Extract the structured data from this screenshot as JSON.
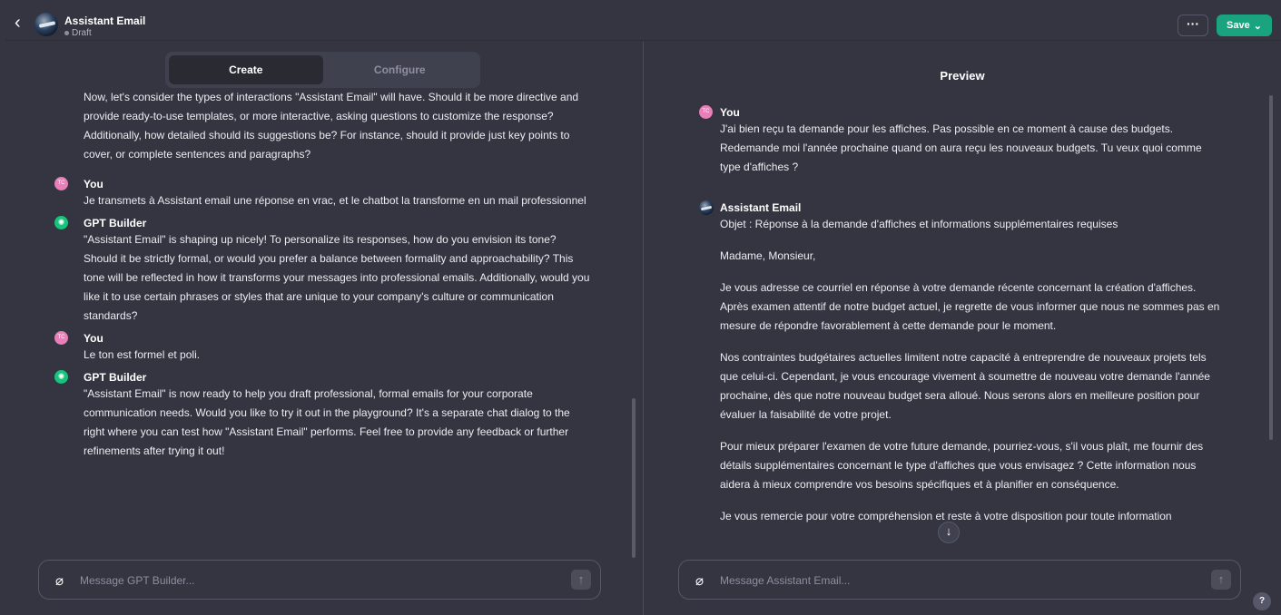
{
  "header": {
    "back_icon": "chevron-left-icon",
    "title": "Assistant Email",
    "status": "Draft",
    "more_label": "···",
    "save_label": "Save"
  },
  "tabs": [
    {
      "label": "Create",
      "active": true
    },
    {
      "label": "Configure",
      "active": false
    }
  ],
  "builder_chat": {
    "intro": "Now, let's consider the types of interactions \"Assistant Email\" will have. Should it be more directive and provide ready-to-use templates, or more interactive, asking questions to customize the response? Additionally, how detailed should its suggestions be? For instance, should it provide just key points to cover, or complete sentences and paragraphs?",
    "messages": [
      {
        "author": "You",
        "initials": "TC",
        "text": "Je transmets à Assistant email une réponse en vrac, et le chatbot la transforme en un mail professionnel"
      },
      {
        "author": "GPT Builder",
        "text": "\"Assistant Email\" is shaping up nicely! To personalize its responses, how do you envision its tone? Should it be strictly formal, or would you prefer a balance between formality and approachability? This tone will be reflected in how it transforms your messages into professional emails. Additionally, would you like it to use certain phrases or styles that are unique to your company's culture or communication standards?"
      },
      {
        "author": "You",
        "initials": "TC",
        "text": "Le ton est formel et poli."
      },
      {
        "author": "GPT Builder",
        "text": "\"Assistant Email\" is now ready to help you draft professional, formal emails for your corporate communication needs. Would you like to try it out in the playground? It's a separate chat dialog to the right where you can test how \"Assistant Email\" performs. Feel free to provide any feedback or further refinements after trying it out!"
      }
    ],
    "input_placeholder": "Message GPT Builder..."
  },
  "preview": {
    "title": "Preview",
    "user_message": {
      "author": "You",
      "initials": "TC",
      "text": "J'ai bien reçu ta demande pour les affiches. Pas possible en ce moment à cause des budgets. Redemande moi l'année prochaine quand on aura reçu les nouveaux budgets. Tu veux quoi comme type d'affiches ?"
    },
    "assistant_message": {
      "author": "Assistant Email",
      "paragraphs": [
        "Objet : Réponse à la demande d'affiches et informations supplémentaires requises",
        "Madame, Monsieur,",
        "Je vous adresse ce courriel en réponse à votre demande récente concernant la création d'affiches. Après examen attentif de notre budget actuel, je regrette de vous informer que nous ne sommes pas en mesure de répondre favorablement à cette demande pour le moment.",
        "Nos contraintes budgétaires actuelles limitent notre capacité à entreprendre de nouveaux projets tels que celui-ci. Cependant, je vous encourage vivement à soumettre de nouveau votre demande l'année prochaine, dès que notre nouveau budget sera alloué. Nous serons alors en meilleure position pour évaluer la faisabilité de votre projet.",
        "Pour mieux préparer l'examen de votre future demande, pourriez-vous, s'il vous plaît, me fournir des détails supplémentaires concernant le type d'affiches que vous envisagez ? Cette information nous aidera à mieux comprendre vos besoins spécifiques et à planifier en conséquence.",
        "Je vous remercie pour votre compréhension et reste à votre disposition pour toute information"
      ]
    },
    "input_placeholder": "Message Assistant Email..."
  },
  "help_label": "?",
  "colors": {
    "background": "#343541",
    "save_green": "#19a37e",
    "gpt_green": "#19c37d",
    "you_pink": "#e97fb8"
  }
}
